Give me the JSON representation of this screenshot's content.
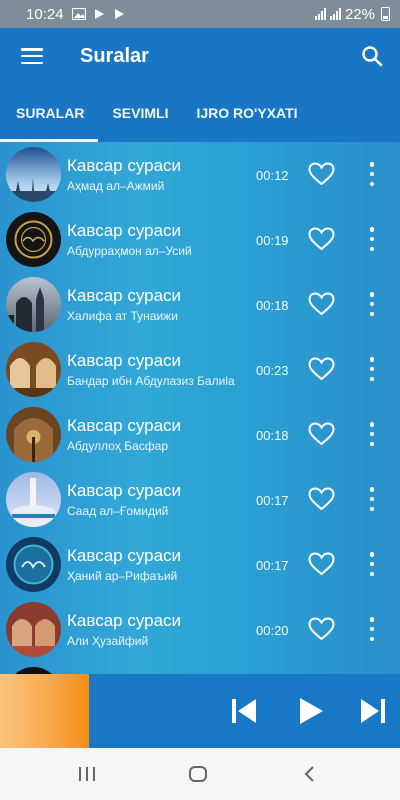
{
  "status_bar": {
    "time": "10:24",
    "battery": "22%"
  },
  "app_bar": {
    "title": "Suralar"
  },
  "tabs": [
    {
      "label": "SURALAR",
      "active": true
    },
    {
      "label": "SEVIMLI",
      "active": false
    },
    {
      "label": "IJRO RO'YXATI",
      "active": false
    }
  ],
  "tracks": [
    {
      "title": "Кавсар сураси",
      "reciter": "Аҳмад ал–Ажмий",
      "duration": "00:12"
    },
    {
      "title": "Кавсар сураси",
      "reciter": "Абдурраҳмон ал–Усий",
      "duration": "00:19"
    },
    {
      "title": "Кавсар сураси",
      "reciter": "Халифа ат Тунаижи",
      "duration": "00:18"
    },
    {
      "title": "Кавсар сураси",
      "reciter": "Бандар ибн Абдулазиз Балиla",
      "duration": "00:23"
    },
    {
      "title": "Кавсар сураси",
      "reciter": "Абдуллоҳ Басфар",
      "duration": "00:18"
    },
    {
      "title": "Кавсар сураси",
      "reciter": "Саад ал–Ғомидий",
      "duration": "00:17"
    },
    {
      "title": "Кавсар сураси",
      "reciter": "Ҳаний ар–Рифаъий",
      "duration": "00:17"
    },
    {
      "title": "Кавсар сураси",
      "reciter": "Али Ҳузайфий",
      "duration": "00:20"
    }
  ],
  "colors": {
    "app_bar": "#1876c4",
    "list_bg": "#2aa0d3",
    "player": "#1878c6",
    "player_art": "#f58c14"
  }
}
